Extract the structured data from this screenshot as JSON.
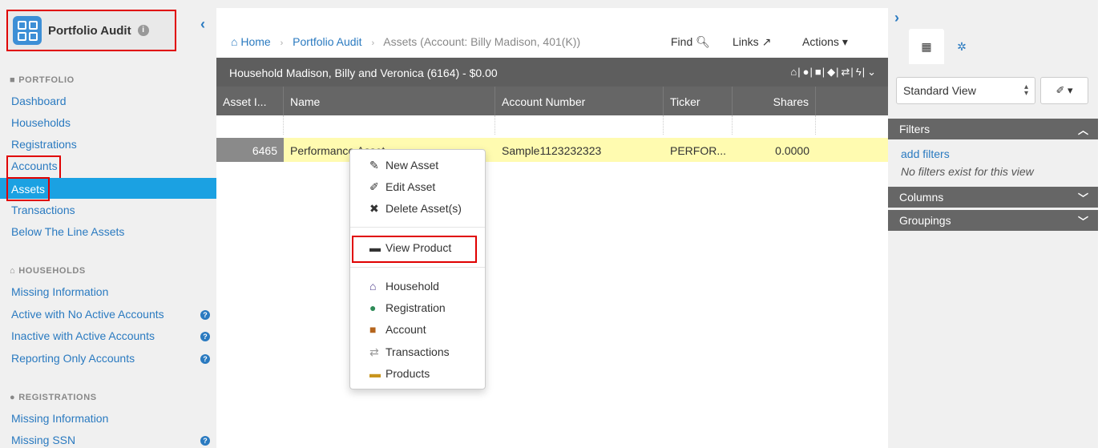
{
  "app": {
    "title": "Portfolio Audit",
    "info_icon": "info-circle-icon"
  },
  "sidebar": {
    "collapse_icon": "‹",
    "sections": {
      "portfolio": {
        "heading": "PORTFOLIO",
        "icon": "briefcase-icon",
        "items": [
          "Dashboard",
          "Households",
          "Registrations",
          "Accounts",
          "Assets",
          "Transactions",
          "Below The Line Assets"
        ],
        "active_item": "Assets"
      },
      "households": {
        "heading": "HOUSEHOLDS",
        "icon": "home-icon",
        "items": [
          "Missing Information",
          "Active with No Active Accounts",
          "Inactive with Active Accounts",
          "Reporting Only Accounts"
        ]
      },
      "registrations": {
        "heading": "REGISTRATIONS",
        "icon": "user-icon",
        "items": [
          "Missing Information",
          "Missing SSN"
        ]
      }
    }
  },
  "breadcrumb": {
    "home": "Home",
    "portfolio_audit": "Portfolio Audit",
    "current": "Assets (Account: Billy Madison, 401(K))"
  },
  "top_actions": {
    "find": "Find",
    "links": "Links",
    "actions": "Actions"
  },
  "household_bar": {
    "label": "Household Madison, Billy and Veronica (6164) - $0.00"
  },
  "table": {
    "headers": [
      "Asset I...",
      "Name",
      "Account Number",
      "Ticker",
      "Shares"
    ],
    "rows": [
      {
        "asset_id": "6465",
        "name": "Performance Asset",
        "account_number": "Sample1123232323",
        "ticker": "PERFOR...",
        "shares": "0.0000"
      }
    ]
  },
  "context_menu": {
    "group1": [
      "New Asset",
      "Edit Asset",
      "Delete Asset(s)"
    ],
    "group2": [
      "View Product"
    ],
    "group3": [
      "Household",
      "Registration",
      "Account",
      "Transactions",
      "Products"
    ]
  },
  "right_panel": {
    "view_select": "Standard View",
    "filters_heading": "Filters",
    "add_filters": "add filters",
    "no_filters_msg": "No filters exist for this view",
    "columns_heading": "Columns",
    "groupings_heading": "Groupings"
  },
  "colors": {
    "accent": "#2a7ac0",
    "active_nav": "#1ba1e2",
    "highlight_row": "#fffbb0",
    "annotation": "#e00000"
  }
}
